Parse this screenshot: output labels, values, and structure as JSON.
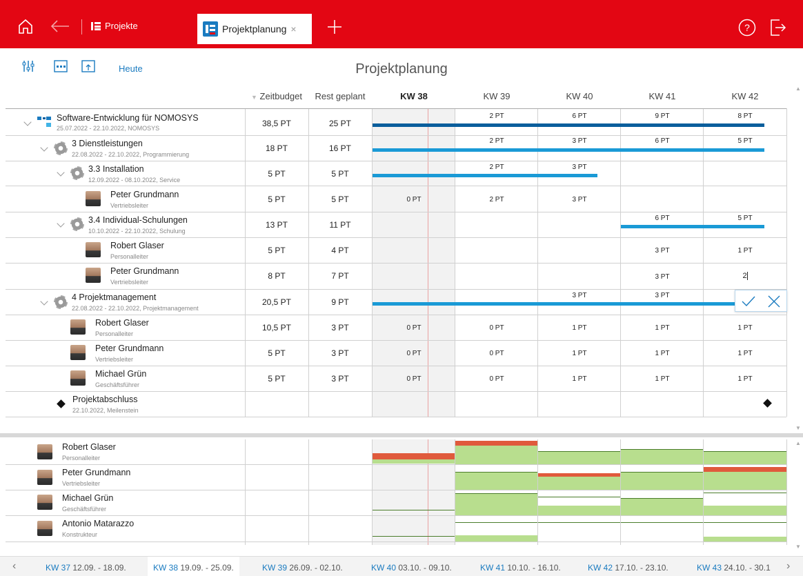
{
  "topbar": {
    "projekte_label": "Projekte",
    "active_tab_label": "Projektplanung",
    "close_symbol": "×",
    "home_icon": "home-icon",
    "back_icon": "arrow-left-icon",
    "add_icon": "plus-icon",
    "help_icon": "help-icon",
    "logout_icon": "logout-icon"
  },
  "toolbar": {
    "title": "Projektplanung",
    "today_label": "Heute",
    "filter_icon": "sliders-icon",
    "week_icon": "calendar-week-icon",
    "export_icon": "calendar-upload-icon"
  },
  "columns": {
    "zeitbudget": "Zeitbudget",
    "rest": "Rest geplant",
    "weeks": [
      "KW 38",
      "KW 39",
      "KW 40",
      "KW 41",
      "KW 42"
    ]
  },
  "rows": [
    {
      "name": "Software-Entwicklung für NOMOSYS",
      "sub": "25.07.2022 - 22.10.2022, NOMOSYS",
      "budget": "38,5 PT",
      "rest": "25 PT",
      "weeks": [
        "",
        "2 PT",
        "6 PT",
        "9 PT",
        "8 PT"
      ]
    },
    {
      "name": "3 Dienstleistungen",
      "sub": "22.08.2022 - 22.10.2022, Programmierung",
      "budget": "18 PT",
      "rest": "16 PT",
      "weeks": [
        "",
        "2 PT",
        "3 PT",
        "6 PT",
        "5 PT"
      ]
    },
    {
      "name": "3.3 Installation",
      "sub": "12.09.2022 - 08.10.2022, Service",
      "budget": "5 PT",
      "rest": "5 PT",
      "weeks": [
        "",
        "2 PT",
        "3 PT",
        "",
        ""
      ]
    },
    {
      "name": "Peter Grundmann",
      "sub": "Vertriebsleiter",
      "budget": "5 PT",
      "rest": "5 PT",
      "weeks": [
        "0 PT",
        "2 PT",
        "3 PT",
        "",
        ""
      ]
    },
    {
      "name": "3.4 Individual-Schulungen",
      "sub": "10.10.2022 - 22.10.2022, Schulung",
      "budget": "13 PT",
      "rest": "11 PT",
      "weeks": [
        "",
        "",
        "",
        "6 PT",
        "5 PT"
      ]
    },
    {
      "name": "Robert Glaser",
      "sub": "Personalleiter",
      "budget": "5 PT",
      "rest": "4 PT",
      "weeks": [
        "",
        "",
        "",
        "3 PT",
        "1 PT"
      ]
    },
    {
      "name": "Peter Grundmann",
      "sub": "Vertriebsleiter",
      "budget": "8 PT",
      "rest": "7 PT",
      "weeks": [
        "",
        "",
        "",
        "3 PT",
        "2"
      ]
    },
    {
      "name": "4 Projektmanagement",
      "sub": "22.08.2022 - 22.10.2022, Projektmanagement",
      "budget": "20,5 PT",
      "rest": "9 PT",
      "weeks": [
        "",
        "",
        "3 PT",
        "3 PT",
        ""
      ]
    },
    {
      "name": "Robert Glaser",
      "sub": "Personalleiter",
      "budget": "10,5 PT",
      "rest": "3 PT",
      "weeks": [
        "0 PT",
        "0 PT",
        "1 PT",
        "1 PT",
        "1 PT"
      ]
    },
    {
      "name": "Peter Grundmann",
      "sub": "Vertriebsleiter",
      "budget": "5 PT",
      "rest": "3 PT",
      "weeks": [
        "0 PT",
        "0 PT",
        "1 PT",
        "1 PT",
        "1 PT"
      ]
    },
    {
      "name": "Michael Grün",
      "sub": "Geschäftsführer",
      "budget": "5 PT",
      "rest": "3 PT",
      "weeks": [
        "0 PT",
        "0 PT",
        "1 PT",
        "1 PT",
        "1 PT"
      ]
    },
    {
      "name": "Projektabschluss",
      "sub": "22.10.2022, Meilenstein",
      "budget": "",
      "rest": "",
      "weeks": [
        "",
        "",
        "",
        "",
        ""
      ]
    }
  ],
  "resources": [
    {
      "name": "Robert Glaser",
      "sub": "Personalleiter"
    },
    {
      "name": "Peter Grundmann",
      "sub": "Vertriebsleiter"
    },
    {
      "name": "Michael Grün",
      "sub": "Geschäftsführer"
    },
    {
      "name": "Antonio Matarazzo",
      "sub": "Konstrukteur"
    }
  ],
  "footer": [
    {
      "kw": "KW 37",
      "range": "12.09. - 18.09."
    },
    {
      "kw": "KW 38",
      "range": "19.09. - 25.09."
    },
    {
      "kw": "KW 39",
      "range": "26.09. - 02.10."
    },
    {
      "kw": "KW 40",
      "range": "03.10. - 09.10."
    },
    {
      "kw": "KW 41",
      "range": "10.10. - 16.10."
    },
    {
      "kw": "KW 42",
      "range": "17.10. - 23.10."
    },
    {
      "kw": "KW 43",
      "range": "24.10. - 30.1"
    }
  ],
  "colors": {
    "brand": "#e30613",
    "bar_dark": "#0a5e9c",
    "bar_light": "#1a9ad6",
    "accent": "#1a7bc0"
  }
}
